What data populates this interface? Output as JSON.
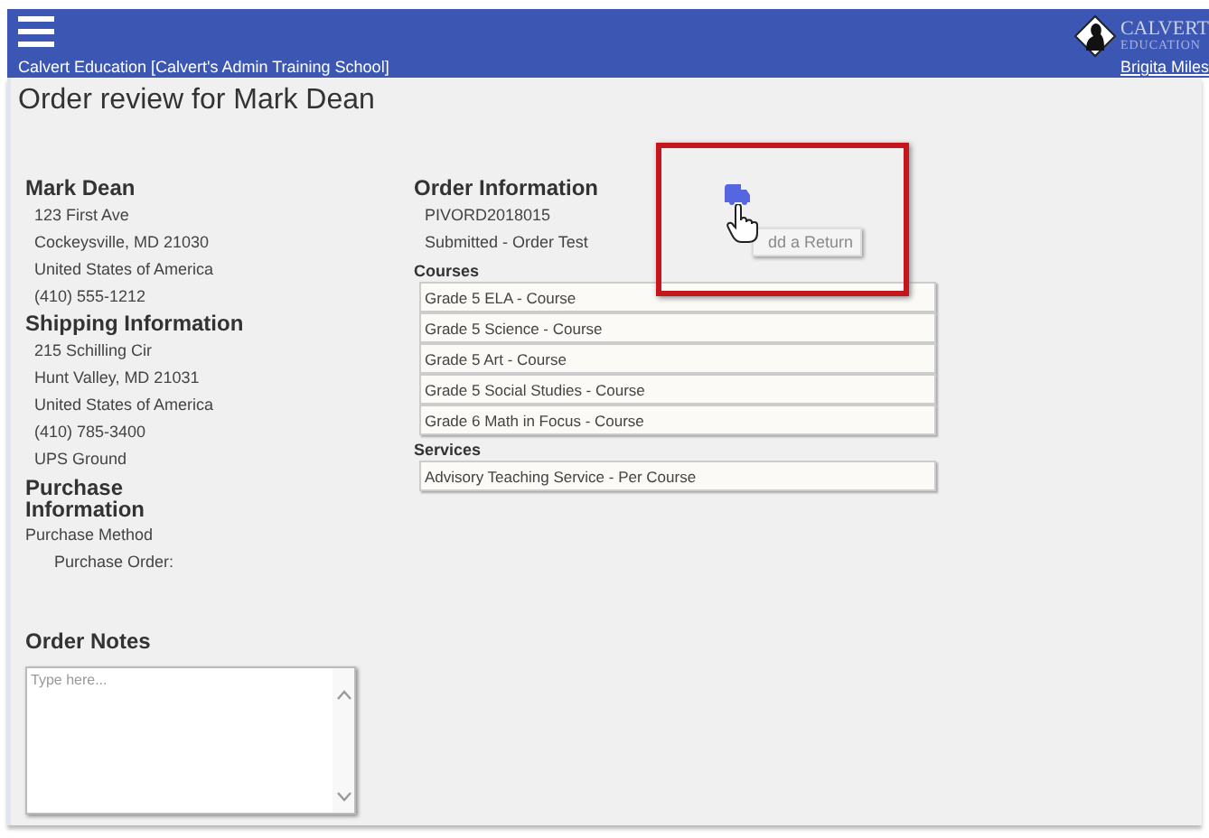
{
  "header": {
    "org_label": "Calvert Education [Calvert's Admin Training School]",
    "user_link": "Brigita Miles",
    "logo": {
      "line1": "CALVERT",
      "line2": "EDUCATION"
    }
  },
  "title": "Order review for Mark Dean",
  "customer": {
    "name": "Mark Dean",
    "lines": [
      "123 First Ave",
      "Cockeysville, MD 21030",
      "United States of America",
      "(410) 555-1212"
    ]
  },
  "shipping": {
    "heading": "Shipping Information",
    "lines": [
      "215 Schilling Cir",
      "Hunt Valley, MD 21031",
      "United States of America",
      "(410) 785-3400",
      "UPS Ground"
    ]
  },
  "purchase": {
    "heading": "Purchase Information",
    "method_label": "Purchase Method",
    "order_label": "Purchase Order:"
  },
  "notes": {
    "heading": "Order Notes",
    "placeholder": "Type here..."
  },
  "order_info": {
    "heading": "Order Information",
    "number": "PIVORD2018015",
    "status": "Submitted - Order Test"
  },
  "courses": {
    "heading": "Courses",
    "items": [
      "Grade 5 ELA - Course",
      "Grade 5 Science - Course",
      "Grade 5 Art - Course",
      "Grade 5 Social Studies - Course",
      "Grade 6 Math in Focus - Course"
    ]
  },
  "services": {
    "heading": "Services",
    "items": [
      "Advisory Teaching Service - Per Course"
    ]
  },
  "tooltip": {
    "text": "dd a Return"
  }
}
